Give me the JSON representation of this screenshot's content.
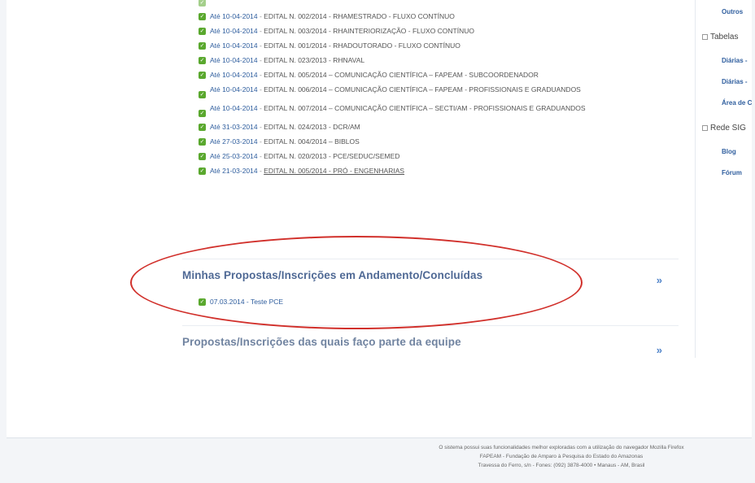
{
  "notices": [
    {
      "date": "Até 10-04-2014",
      "text": "EDITAL N. 002/2014 - RHAMESTRADO - FLUXO CONTÍNUO"
    },
    {
      "date": "Até 10-04-2014",
      "text": "EDITAL N. 003/2014 - RHAINTERIORIZAÇÃO - FLUXO CONTÍNUO"
    },
    {
      "date": "Até 10-04-2014",
      "text": "EDITAL N. 001/2014 - RHADOUTORADO - FLUXO CONTÍNUO"
    },
    {
      "date": "Até 10-04-2014",
      "text": "EDITAL N. 023/2013 - RHNAVAL"
    },
    {
      "date": "Até 10-04-2014",
      "text": "EDITAL N. 005/2014 – COMUNICAÇÃO CIENTÍFICA – FAPEAM - SUBCOORDENADOR"
    },
    {
      "date": "Até 10-04-2014",
      "text": "EDITAL N. 006/2014 – COMUNICAÇÃO CIENTÍFICA – FAPEAM - PROFISSIONAIS E GRADUANDOS"
    },
    {
      "date": "Até 10-04-2014",
      "text": "EDITAL N. 007/2014 – COMUNICAÇÃO CIENTÍFICA – SECTI/AM - PROFISSIONAIS E GRADUANDOS"
    },
    {
      "date": "Até 31-03-2014",
      "text": "EDITAL N. 024/2013 - DCR/AM"
    },
    {
      "date": "Até 27-03-2014",
      "text": "EDITAL N. 004/2014 – BIBLOS"
    },
    {
      "date": "Até 25-03-2014",
      "text": "EDITAL N. 020/2013 - PCE/SEDUC/SEMED"
    },
    {
      "date": "Até 21-03-2014",
      "text": "EDITAL N. 005/2014 - PRÓ - ENGENHARIAS"
    }
  ],
  "separator": " - ",
  "sections": {
    "my_proposals": {
      "title": "Minhas Propostas/Inscrições em Andamento/Concluídas",
      "expand": "»",
      "items": [
        {
          "text": "07.03.2014 - Teste PCE"
        }
      ]
    },
    "team_proposals": {
      "title": "Propostas/Inscrições das quais faço parte da equipe",
      "expand": "»"
    }
  },
  "sidebar": {
    "outros": "Outros",
    "tabelas": "Tabelas",
    "tabelas_links": [
      "Diárias -",
      "Diárias -",
      "Área de C"
    ],
    "rede": "Rede SIG",
    "rede_links": [
      "Blog",
      "Fórum"
    ]
  },
  "footer": {
    "line1": "O sistema possui suas funcionalidades melhor exploradas com a utilização do navegador Mozilla Firefox",
    "line2": "FAPEAM - Fundação de Amparo à Pesquisa do Estado do Amazonas",
    "line3": "Travessa do Ferro, s/n - Fones: (092) 3878-4000 • Manaus - AM, Brasil"
  },
  "colors": {
    "accent": "#4f6995",
    "link": "#2f5e9e",
    "check": "#5aa82e",
    "annotation": "#d1302b"
  }
}
